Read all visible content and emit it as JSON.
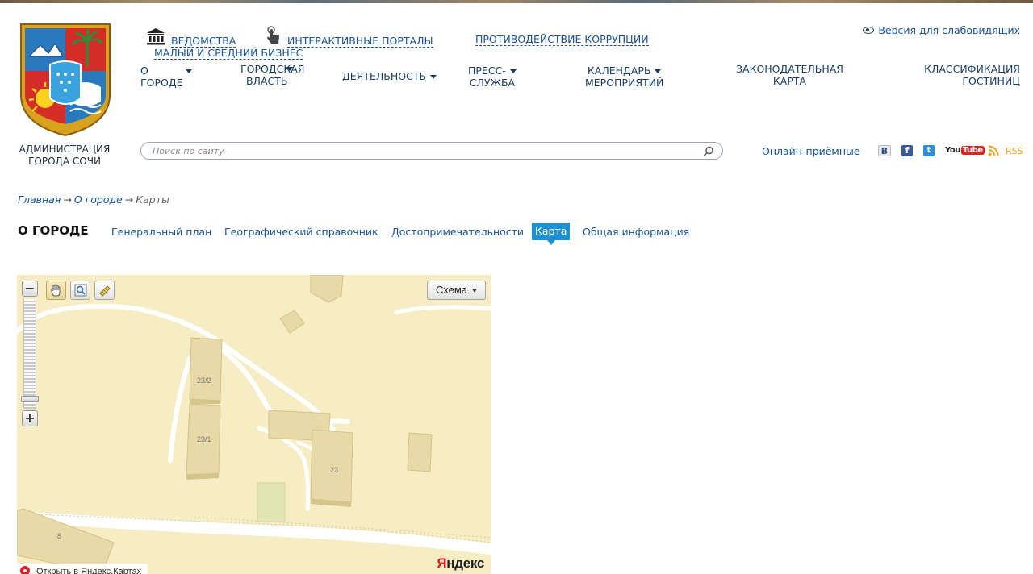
{
  "site": {
    "org_name": "Администрация города Сочи"
  },
  "toplinks": {
    "vedomstva": "ВЕДОМСТВА",
    "portals": "ИНТЕРАКТИВНЫЕ ПОРТАЛЫ",
    "corruption": "ПРОТИВОДЕЙСТВИЕ КОРРУПЦИИ",
    "business": "МАЛЫЙ И СРЕДНИЙ БИЗНЕС",
    "low_vision": "Версия для слабовидящих"
  },
  "nav": {
    "about_l1": "О",
    "about_l2": "ГОРОДЕ",
    "power_l1": "ГОРОДСКАЯ",
    "power_l2": "ВЛАСТЬ",
    "activity": "ДЕЯТЕЛЬНОСТЬ",
    "press_l1": "ПРЕСС-",
    "press_l2": "СЛУЖБА",
    "calendar_l1": "КАЛЕНДАРЬ",
    "calendar_l2": "МЕРОПРИЯТИЙ",
    "legmap_l1": "ЗАКОНОДАТЕЛЬНАЯ",
    "legmap_l2": "КАРТА",
    "hotels_l1": "КЛАССИФИКАЦИЯ",
    "hotels_l2": "ГОСТИНИЦ"
  },
  "search": {
    "placeholder": "Поиск по сайту"
  },
  "online_reception": "Онлайн-приёмные",
  "social": {
    "vk": "B",
    "facebook": "f",
    "twitter": "t",
    "youtube_a": "You",
    "youtube_b": "Tube",
    "rss": "RSS"
  },
  "breadcrumb": {
    "home": "Главная",
    "about": "О городе",
    "current": "Карты",
    "arrow": "→"
  },
  "section": {
    "title": "О ГОРОДЕ",
    "tabs": [
      "Генеральный план",
      "Географический справочник",
      "Достопримечательности",
      "Карта",
      "Общая информация"
    ],
    "active_tab": "Карта"
  },
  "map": {
    "layer_label": "Схема",
    "open_link": "Открыть в Яндекс.Картах",
    "logo_y": "Я",
    "logo_rest": "ндекс",
    "building_labels": [
      "23/2",
      "23/1",
      "23",
      "8"
    ],
    "colors": {
      "land": "#f6edc5",
      "building": "#e8d9a8",
      "road": "#ffffff"
    }
  },
  "colors": {
    "link": "#17529b",
    "active_tab": "#1d8fd4"
  }
}
